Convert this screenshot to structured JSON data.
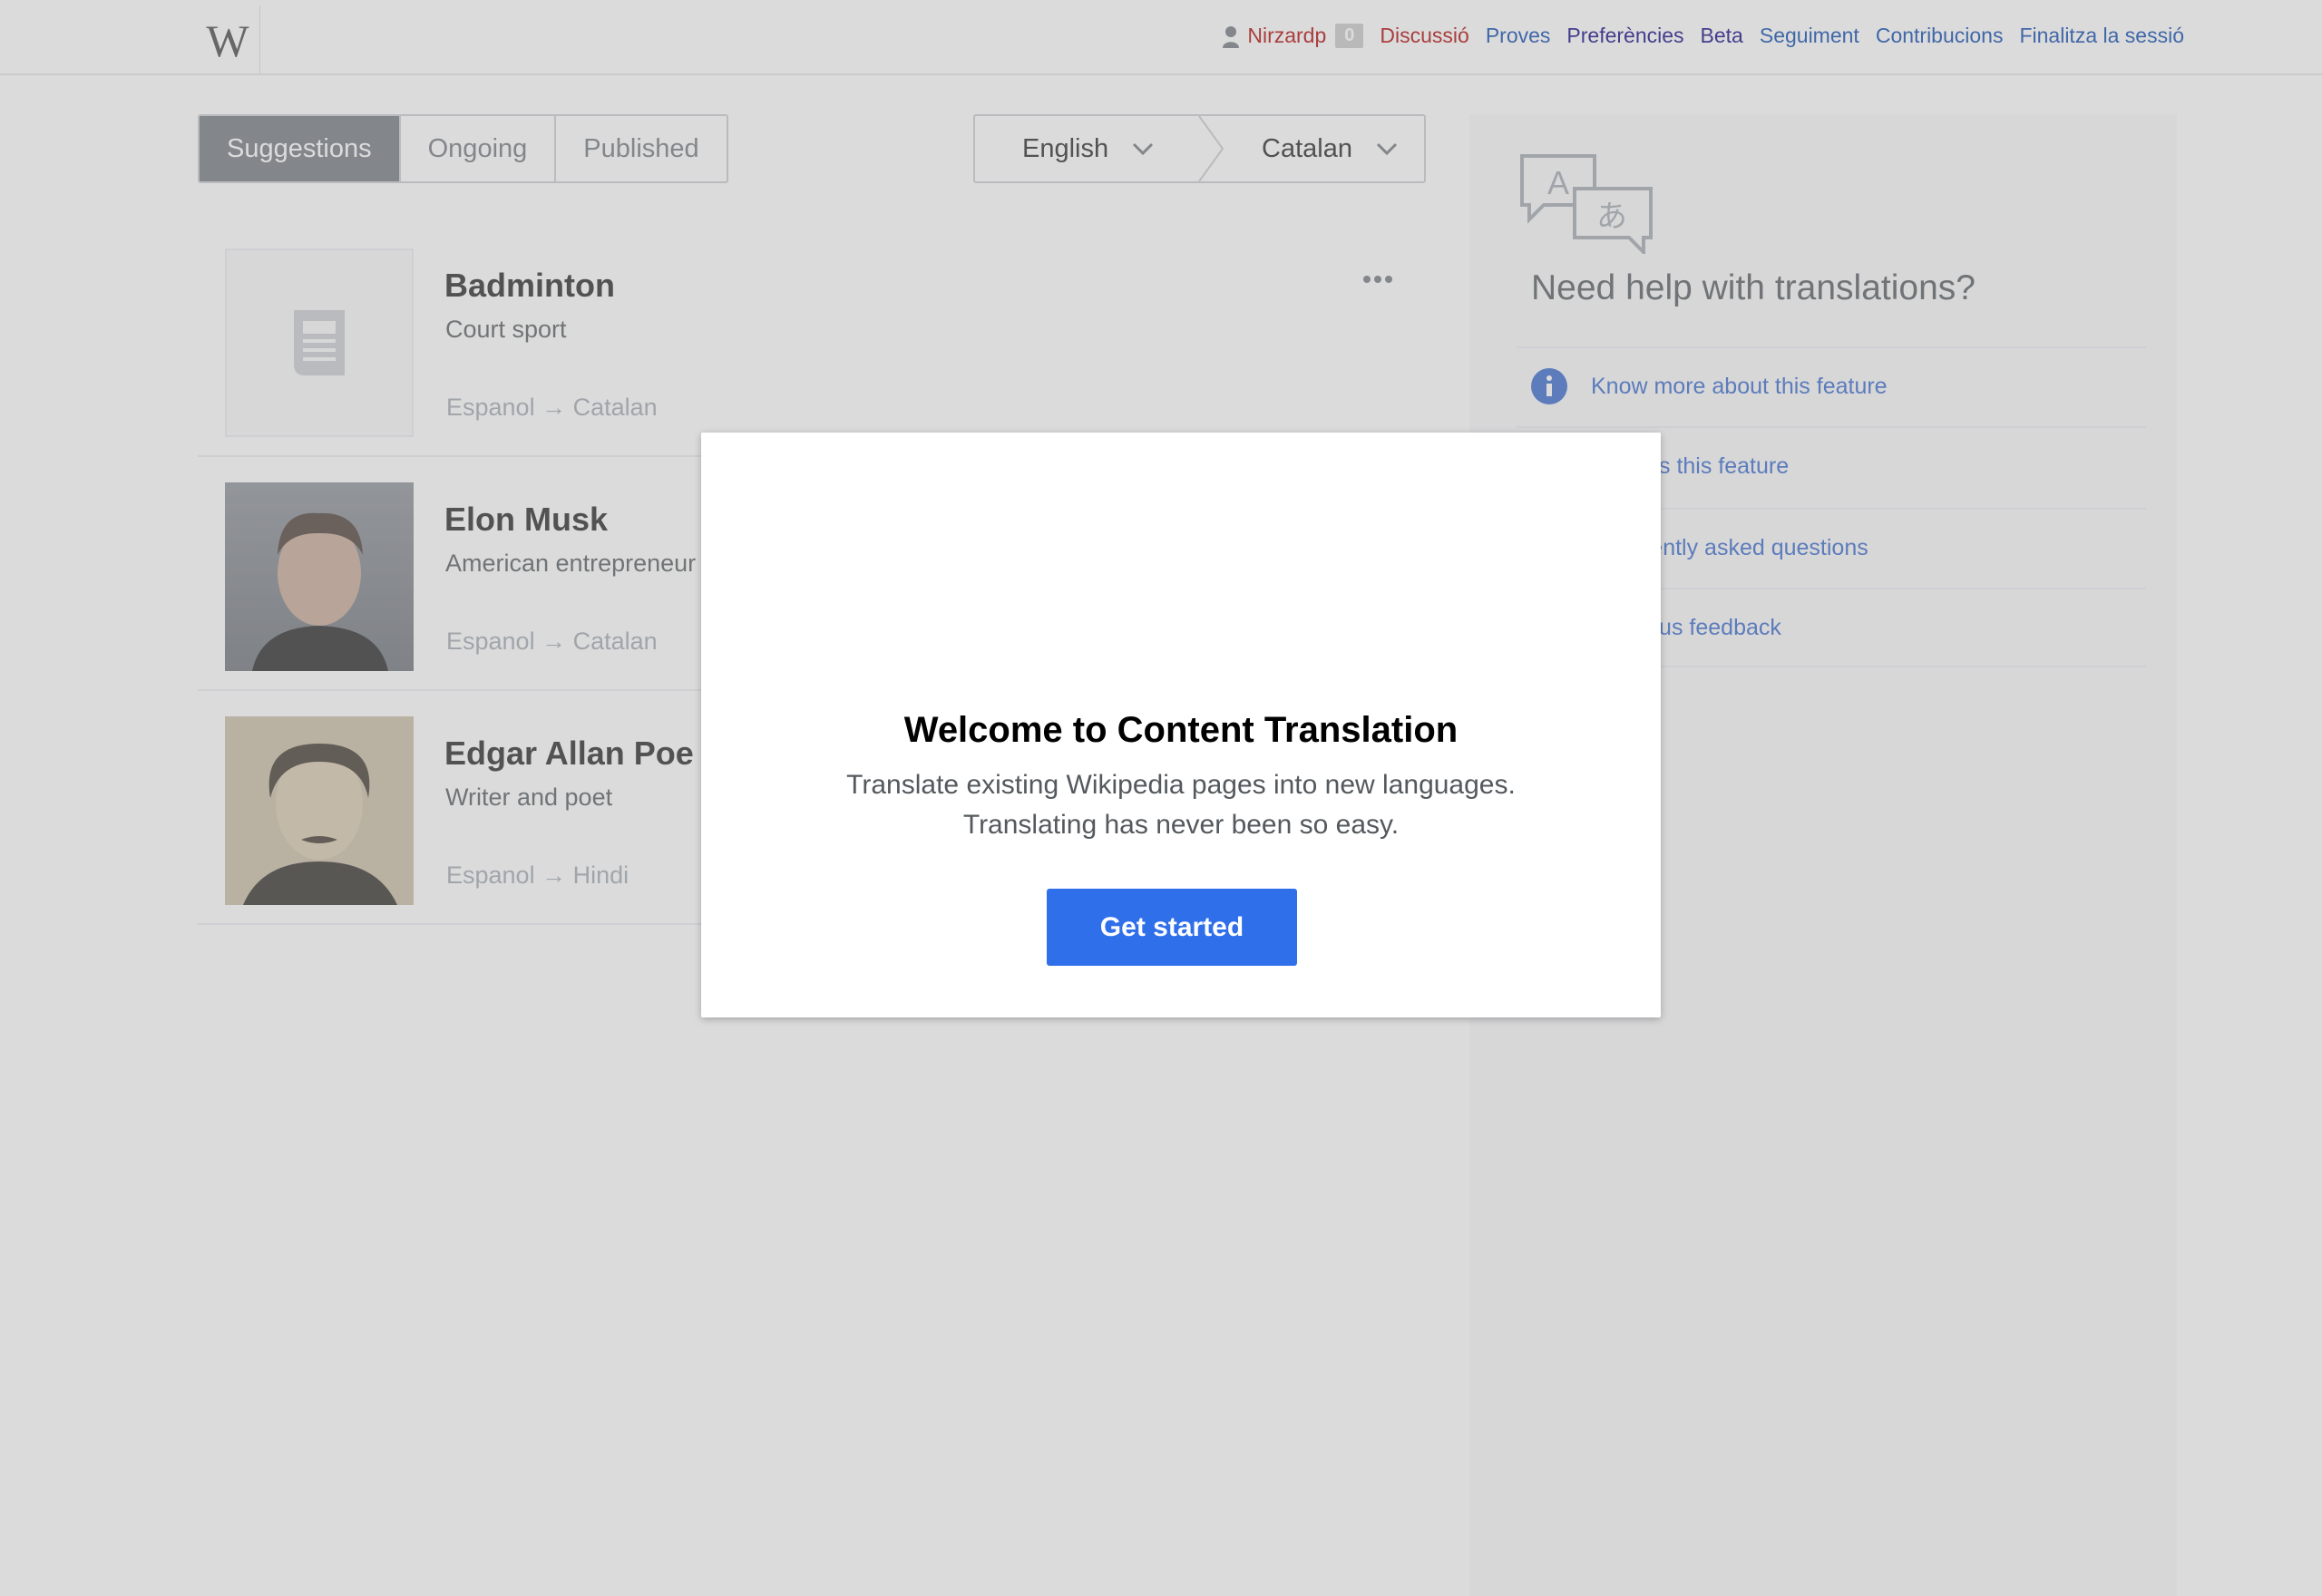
{
  "topbar": {
    "logo_text": "W",
    "user_name": "Nirzardp",
    "notification_count": "0",
    "links": {
      "talk": "Discussió",
      "sandbox": "Proves",
      "preferences": "Preferències",
      "beta": "Beta",
      "watchlist": "Seguiment",
      "contributions": "Contribucions",
      "logout": "Finalitza la sessió"
    }
  },
  "tabs": [
    {
      "label": "Suggestions",
      "active": true
    },
    {
      "label": "Ongoing",
      "active": false
    },
    {
      "label": "Published",
      "active": false
    }
  ],
  "language_selector": {
    "source": "English",
    "target": "Catalan"
  },
  "cards": [
    {
      "title": "Badminton",
      "description": "Court sport",
      "languages": "Espanol → Catalan",
      "thumbnail": "placeholder-article-icon"
    },
    {
      "title": "Elon Musk",
      "description": "American entrepreneur",
      "languages": "Espanol → Catalan",
      "thumbnail": "photo-portrait"
    },
    {
      "title": "Edgar Allan Poe",
      "description": "Writer and poet",
      "languages": "Espanol → Hindi",
      "thumbnail": "photo-portrait-sepia"
    }
  ],
  "help_panel": {
    "title": "Need help with translations?",
    "items": [
      {
        "label": "Know more about this feature",
        "icon": "info-icon"
      },
      {
        "label": "Discuss this feature"
      },
      {
        "label": "Frequently asked questions"
      },
      {
        "label": "Leave us feedback"
      }
    ]
  },
  "modal": {
    "title": "Welcome to Content Translation",
    "line1": "Translate existing Wikipedia pages into new languages.",
    "line2": "Translating has never been so easy.",
    "button": "Get started"
  },
  "colors": {
    "link": "#0645ad",
    "red_link": "#b00000",
    "primary_button": "#2f6fea",
    "overlay": "rgba(160,160,160,0.38)"
  }
}
